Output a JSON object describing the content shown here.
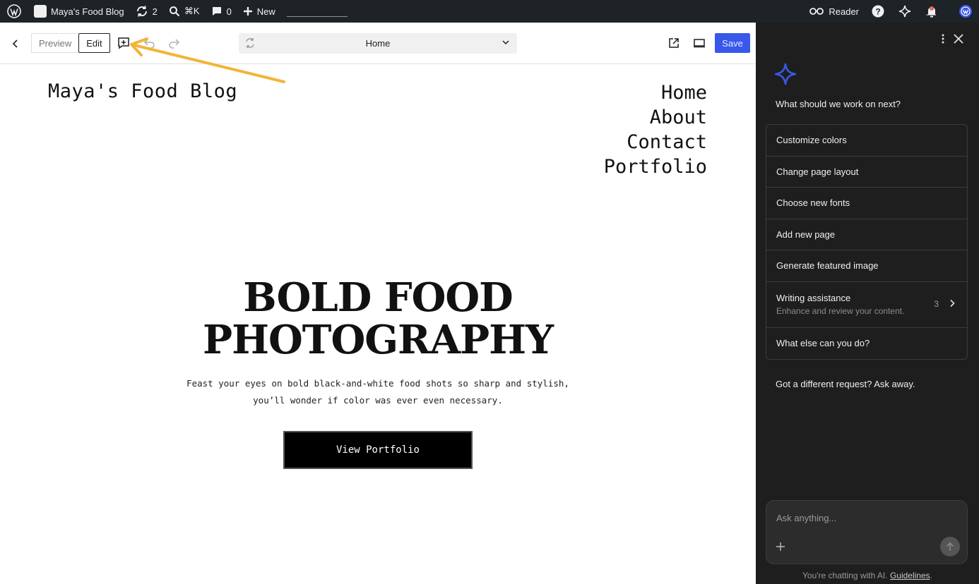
{
  "adminbar": {
    "site_name": "Maya's Food Blog",
    "updates_count": "2",
    "search_shortcut": "⌘K",
    "comments_count": "0",
    "new_label": "New",
    "reader_label": "Reader"
  },
  "toolbar": {
    "preview_label": "Preview",
    "edit_label": "Edit",
    "document_title": "Home",
    "save_label": "Save"
  },
  "canvas": {
    "site_title": "Maya's Food Blog",
    "nav": [
      "Home",
      "About",
      "Contact",
      "Portfolio"
    ],
    "hero_title_line1": "BOLD FOOD",
    "hero_title_line2": "PHOTOGRAPHY",
    "hero_desc_line1": "Feast your eyes on bold black-and-white food shots so sharp and stylish,",
    "hero_desc_line2": "you’ll wonder if color was ever even necessary.",
    "cta_label": "View Portfolio"
  },
  "assistant": {
    "question": "What should we work on next?",
    "suggestions": [
      {
        "label": "Customize colors"
      },
      {
        "label": "Change page layout"
      },
      {
        "label": "Choose new fonts"
      },
      {
        "label": "Add new page"
      },
      {
        "label": "Generate featured image"
      },
      {
        "label": "Writing assistance",
        "sub": "Enhance and review your content.",
        "count": "3"
      },
      {
        "label": "What else can you do?"
      }
    ],
    "different_request": "Got a different request? Ask away.",
    "input_placeholder": "Ask anything...",
    "disclaimer_prefix": "You're chatting with AI.",
    "guidelines_link": "Guidelines",
    "disclaimer_suffix": "."
  },
  "colors": {
    "accent": "#3858e9",
    "admin_bar": "#1d2327",
    "panel_bg": "#1e1e1e",
    "annotation_arrow": "#f2b538"
  },
  "icons": [
    "wordpress-logo-icon",
    "site-icon",
    "updates-icon",
    "search-icon",
    "comment-icon",
    "plus-icon",
    "reader-icon",
    "help-icon",
    "sparkle-icon",
    "bell-icon",
    "avatar-icon",
    "back-arrow-icon",
    "add-block-icon",
    "undo-icon",
    "redo-icon",
    "sync-icon",
    "chevron-down-icon",
    "external-link-icon",
    "desktop-view-icon",
    "more-vertical-icon",
    "close-icon",
    "chevron-right-icon",
    "send-arrow-icon"
  ]
}
